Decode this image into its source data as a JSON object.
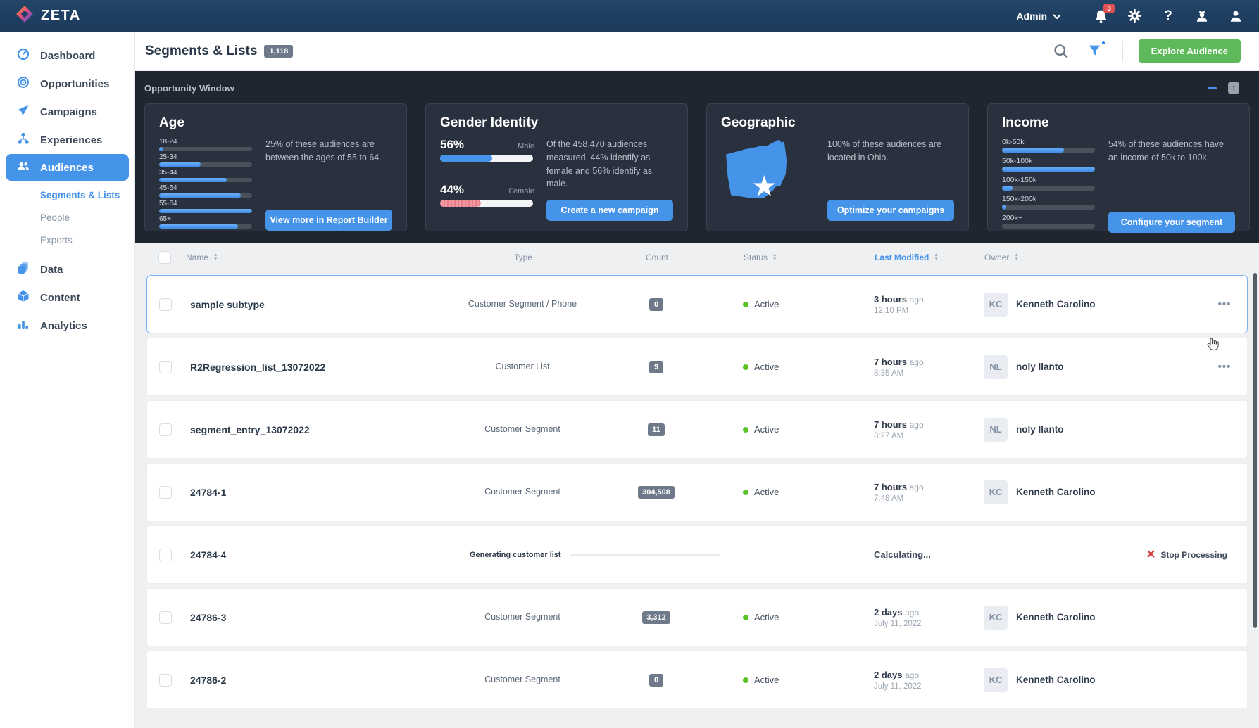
{
  "navbar": {
    "brand": "ZETA",
    "admin_label": "Admin",
    "notification_count": "3"
  },
  "sidebar": {
    "items": [
      {
        "label": "Dashboard"
      },
      {
        "label": "Opportunities"
      },
      {
        "label": "Campaigns"
      },
      {
        "label": "Experiences"
      },
      {
        "label": "Audiences"
      },
      {
        "label": "Data"
      },
      {
        "label": "Content"
      },
      {
        "label": "Analytics"
      }
    ],
    "audiences_sub": [
      {
        "label": "Segments & Lists"
      },
      {
        "label": "People"
      },
      {
        "label": "Exports"
      }
    ]
  },
  "header": {
    "title": "Segments & Lists",
    "count_badge": "1,118",
    "explore_button": "Explore Audience"
  },
  "opportunity": {
    "title": "Opportunity Window",
    "age": {
      "title": "Age",
      "description": "25% of these audiences are between the ages of 55 to 64.",
      "button": "View more in Report Builder",
      "bars": [
        {
          "label": "18-24",
          "value": 4
        },
        {
          "label": "25-34",
          "value": 45
        },
        {
          "label": "35-44",
          "value": 73
        },
        {
          "label": "45-54",
          "value": 88
        },
        {
          "label": "55-64",
          "value": 100
        },
        {
          "label": "65+",
          "value": 85
        }
      ]
    },
    "gender": {
      "title": "Gender Identity",
      "description": "Of the 458,470 audiences measured, 44% identify as female and 56% identify as male.",
      "button": "Create a new campaign",
      "male_pct": "56%",
      "male_label": "Male",
      "male_value": 56,
      "female_pct": "44%",
      "female_label": "Female",
      "female_value": 44
    },
    "geographic": {
      "title": "Geographic",
      "description": "100% of these audiences are located in Ohio.",
      "button": "Optimize your campaigns",
      "state": "Ohio"
    },
    "income": {
      "title": "Income",
      "description": "54% of these audiences have an income of 50k to 100k.",
      "button": "Configure your segment",
      "bars": [
        {
          "label": "0k-50k",
          "value": 67
        },
        {
          "label": "50k-100k",
          "value": 100
        },
        {
          "label": "100k-150k",
          "value": 11
        },
        {
          "label": "150k-200k",
          "value": 4
        },
        {
          "label": "200k+",
          "value": 0
        }
      ]
    }
  },
  "table": {
    "columns": {
      "name": "Name",
      "type": "Type",
      "count": "Count",
      "status": "Status",
      "modified": "Last Modified",
      "owner": "Owner"
    },
    "rows": [
      {
        "name": "sample subtype",
        "type": "Customer Segment / Phone",
        "count": "0",
        "status": "Active",
        "time": "3 hours",
        "time_suffix": "ago",
        "time_sub": "12:10 PM",
        "owner": "Kenneth Carolino",
        "initials": "KC"
      },
      {
        "name": "R2Regression_list_13072022",
        "type": "Customer List",
        "count": "9",
        "status": "Active",
        "time": "7 hours",
        "time_suffix": "ago",
        "time_sub": "8:35 AM",
        "owner": "noly llanto",
        "initials": "NL"
      },
      {
        "name": "segment_entry_13072022",
        "type": "Customer Segment",
        "count": "11",
        "status": "Active",
        "time": "7 hours",
        "time_suffix": "ago",
        "time_sub": "8:27 AM",
        "owner": "noly llanto",
        "initials": "NL"
      },
      {
        "name": "24784-1",
        "type": "Customer Segment",
        "count": "304,508",
        "status": "Active",
        "time": "7 hours",
        "time_suffix": "ago",
        "time_sub": "7:48 AM",
        "owner": "Kenneth Carolino",
        "initials": "KC"
      },
      {
        "name": "24784-4",
        "processing_label": "Generating customer list",
        "calculating": "Calculating...",
        "stop_label": "Stop Processing"
      },
      {
        "name": "24786-3",
        "type": "Customer Segment",
        "count": "3,312",
        "status": "Active",
        "time": "2 days",
        "time_suffix": "ago",
        "time_sub": "July 11, 2022",
        "owner": "Kenneth Carolino",
        "initials": "KC"
      },
      {
        "name": "24786-2",
        "type": "Customer Segment",
        "count": "0",
        "status": "Active",
        "time": "2 days",
        "time_suffix": "ago",
        "time_sub": "July 11, 2022",
        "owner": "Kenneth Carolino",
        "initials": "KC"
      }
    ]
  },
  "colors": {
    "accent_blue": "#4693ea",
    "explore_green": "#5eb95a",
    "badge_gray": "#6e7a89",
    "active_dot_green": "#58c322",
    "stop_red": "#cf3b36",
    "female_pink": "#ee8d96",
    "navbar_navy": "#1c3a5c"
  }
}
